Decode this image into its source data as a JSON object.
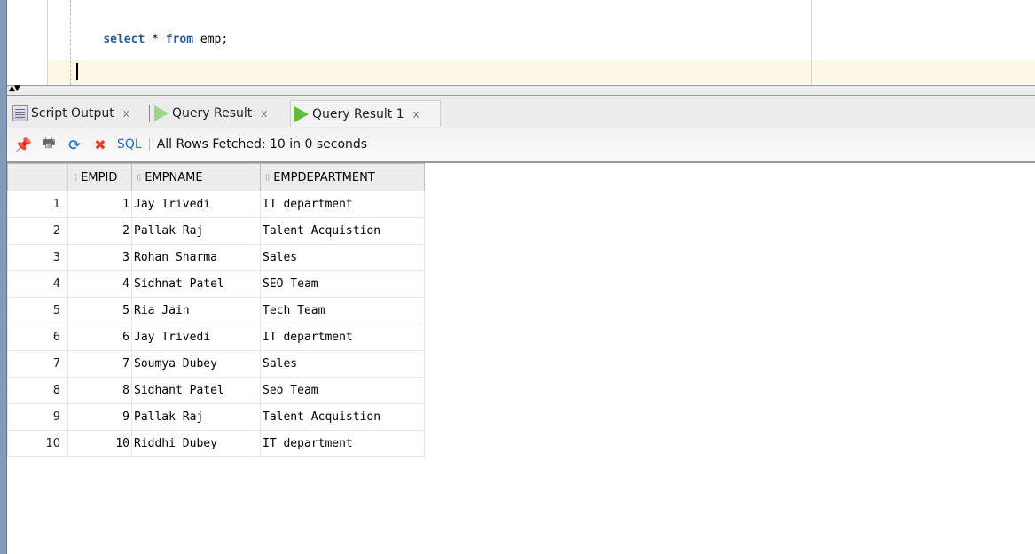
{
  "editor": {
    "code": [
      {
        "text": "select",
        "kw": true
      },
      {
        "text": " * ",
        "kw": false
      },
      {
        "text": "from",
        "kw": true
      },
      {
        "text": " emp;",
        "kw": false
      }
    ]
  },
  "tabs": [
    {
      "label": "Script Output",
      "icon": "script-output-icon",
      "close": "x",
      "active": false
    },
    {
      "label": "Query Result",
      "icon": "run-icon",
      "close": "x",
      "active": false
    },
    {
      "label": "Query Result 1",
      "icon": "run-icon",
      "close": "x",
      "active": true
    }
  ],
  "toolbar": {
    "icons": [
      "pin-icon",
      "print-icon",
      "refresh-icon",
      "clear-icon"
    ],
    "sql_label": "SQL",
    "status": "All Rows Fetched: 10 in 0 seconds"
  },
  "grid": {
    "columns": [
      "EMPID",
      "EMPNAME",
      "EMPDEPARTMENT"
    ],
    "rows": [
      {
        "n": "1",
        "id": "1",
        "name": "Jay Trivedi",
        "dept": "IT department"
      },
      {
        "n": "2",
        "id": "2",
        "name": "Pallak Raj",
        "dept": "Talent Acquistion"
      },
      {
        "n": "3",
        "id": "3",
        "name": "Rohan Sharma",
        "dept": "Sales"
      },
      {
        "n": "4",
        "id": "4",
        "name": "Sidhnat Patel",
        "dept": "SEO Team"
      },
      {
        "n": "5",
        "id": "5",
        "name": "Ria Jain",
        "dept": "Tech Team"
      },
      {
        "n": "6",
        "id": "6",
        "name": "Jay Trivedi",
        "dept": "IT department"
      },
      {
        "n": "7",
        "id": "7",
        "name": "Soumya Dubey",
        "dept": "Sales"
      },
      {
        "n": "8",
        "id": "8",
        "name": "Sidhant Patel",
        "dept": "Seo Team"
      },
      {
        "n": "9",
        "id": "9",
        "name": "Pallak Raj",
        "dept": "Talent Acquistion"
      },
      {
        "n": "10",
        "id": "10",
        "name": "Riddhi Dubey",
        "dept": "IT department"
      }
    ]
  }
}
